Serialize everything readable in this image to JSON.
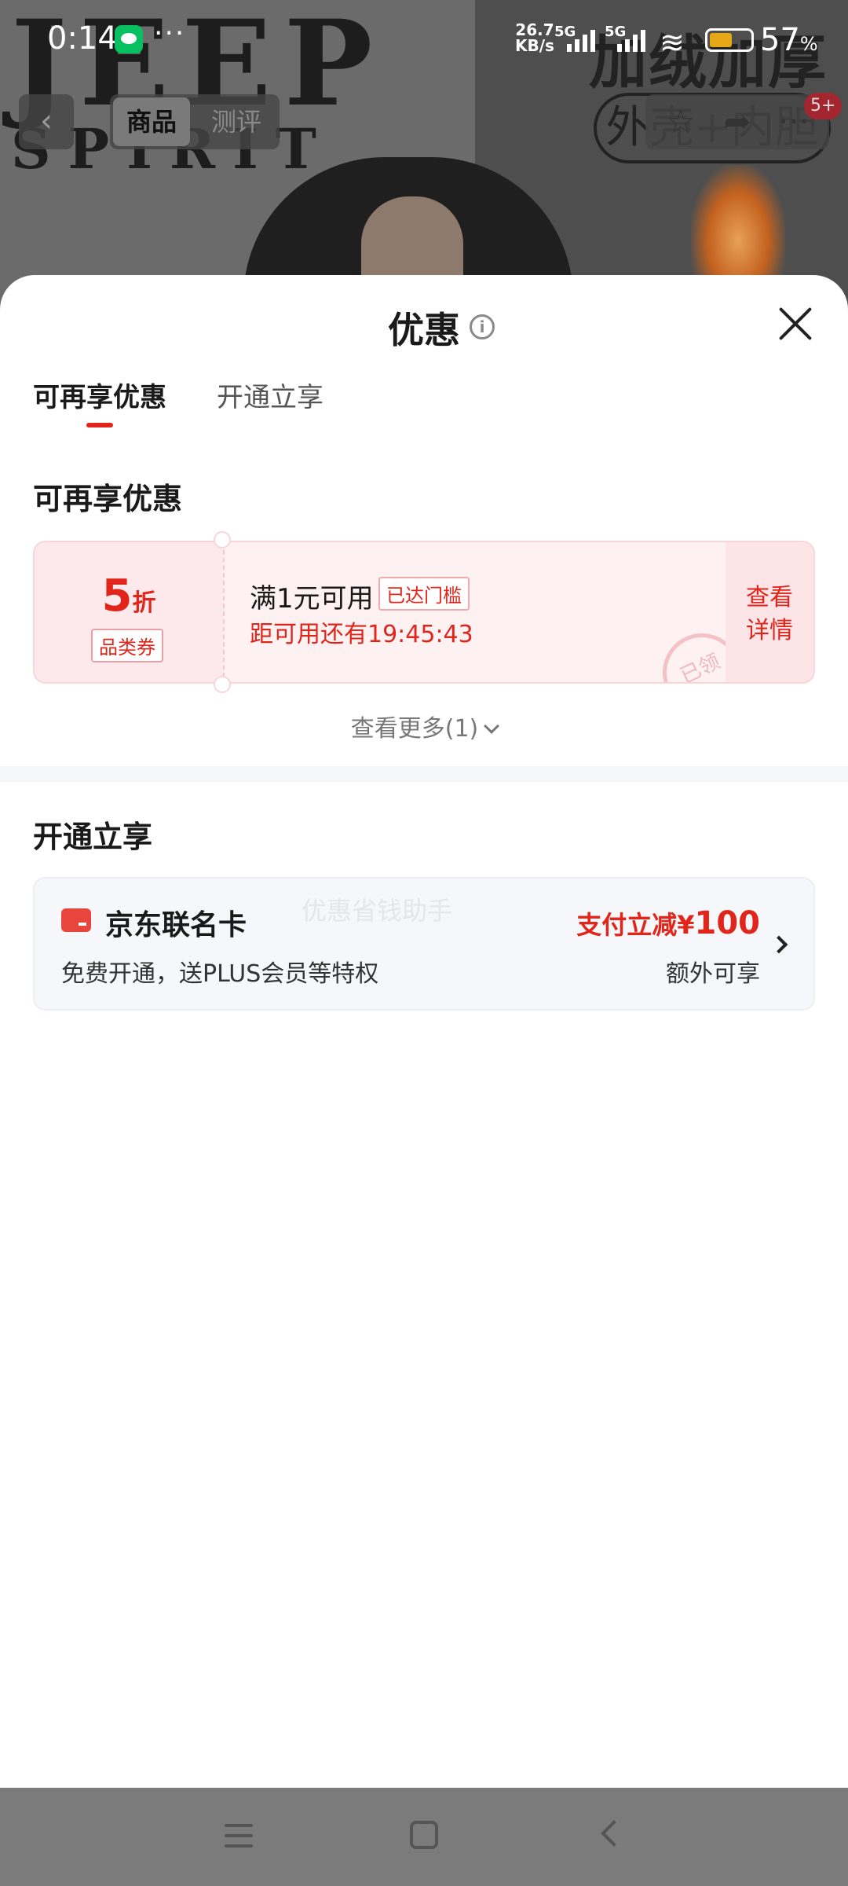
{
  "status_bar": {
    "time": "0:14",
    "dots": "···",
    "net_speed": "26.7",
    "net_unit": "KB/s",
    "sim1": "5G",
    "sim2": "5G",
    "battery_pct": "57",
    "battery_pct_unit": "%",
    "battery_level": 0.57
  },
  "product_bg": {
    "brand_line1": "JEEP",
    "brand_line2": "SPIRIT",
    "banner_text": "加绒加厚",
    "banner_pill": "外壳+内胆"
  },
  "product_nav": {
    "back_icon": "‹",
    "tab_product": "商品",
    "tab_review": "测评",
    "star_icon": "☆",
    "share_icon": "➦",
    "more_icon": "···",
    "badge": "5+"
  },
  "sheet": {
    "title": "优惠",
    "info_icon": "i",
    "tabs": [
      "可再享优惠",
      "开通立享"
    ],
    "section1_title": "可再享优惠",
    "coupon": {
      "discount_num": "5",
      "discount_unit": "折",
      "type_label": "品类券",
      "condition": "满1元可用",
      "tag": "已达门槛",
      "timer": "距可用还有19:45:43",
      "stamp": "已领",
      "action_line1": "查看",
      "action_line2": "详情"
    },
    "more_link": "查看更多(1)",
    "section2_title": "开通立享",
    "card_offer": {
      "name": "京东联名卡",
      "watermark": "优惠省钱助手",
      "desc": "免费开通，送PLUS会员等特权",
      "discount_prefix": "支付立减¥",
      "discount_amount": "100",
      "extra": "额外可享"
    }
  },
  "colors": {
    "accent_red": "#e1251b",
    "coupon_bg": "#fdf1f2",
    "card_bg": "#f6f7fa",
    "wechat_green": "#07c160",
    "battery_fill": "#e6a817"
  }
}
